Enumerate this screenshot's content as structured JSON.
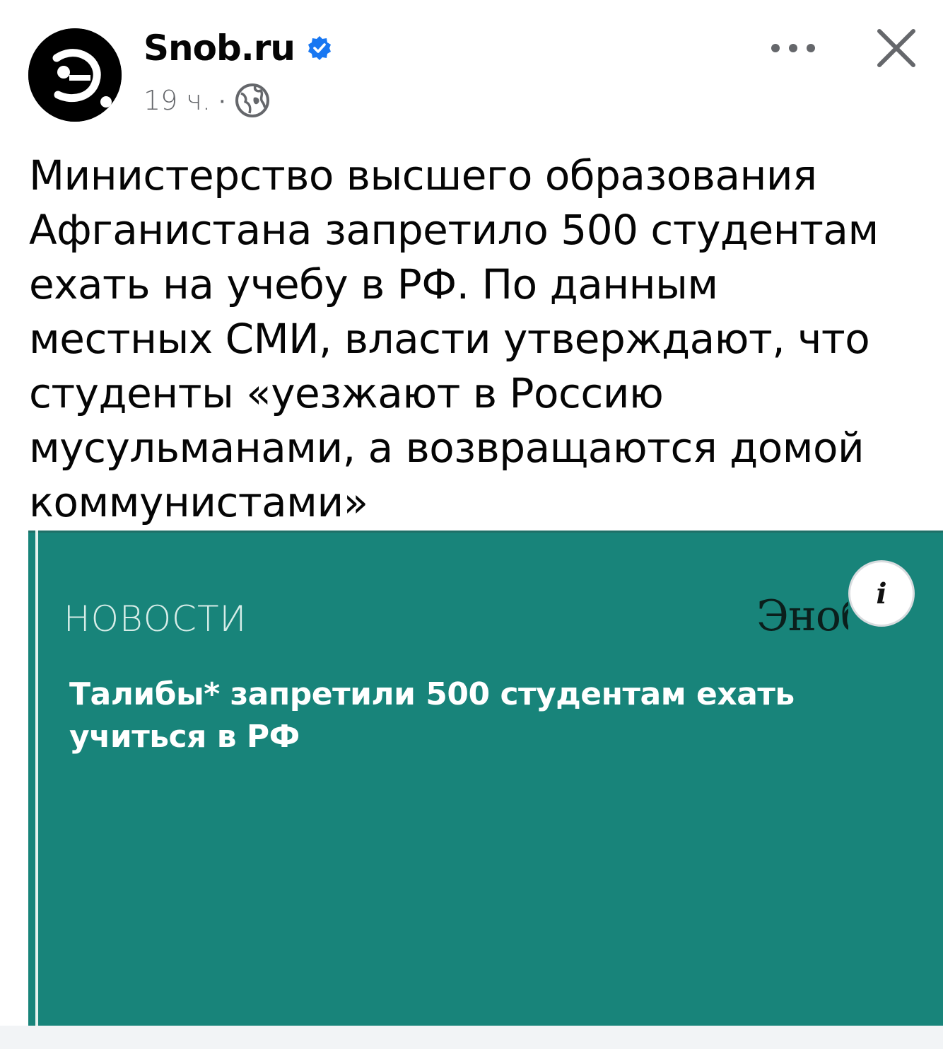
{
  "post": {
    "page_name": "Snob.ru",
    "verified_icon": "verified-badge-icon",
    "time": "19 ч.",
    "meta_separator": "·",
    "audience_icon": "globe-icon",
    "more_icon": "more-dots-icon",
    "close_icon": "close-icon",
    "text": "Министерство высшего образования\nАфганистана запретило 500 студентам\nехать на учебу в РФ. По данным\nместных СМИ, власти утверждают, что\nстуденты «уезжают в Россию\nмусульманами, а возвращаются домой\nкоммунистами»"
  },
  "link_preview": {
    "section_label": "НОВОСТИ",
    "logo_text": "Эноб",
    "headline_line1": "Талибы* запретили 500 студентам ехать",
    "headline_line2": "учиться в РФ",
    "info_icon": "info-icon",
    "info_glyph": "i"
  },
  "colors": {
    "card_background": "#18847a",
    "verified_blue": "#1877f2",
    "secondary_text": "#65676b"
  }
}
